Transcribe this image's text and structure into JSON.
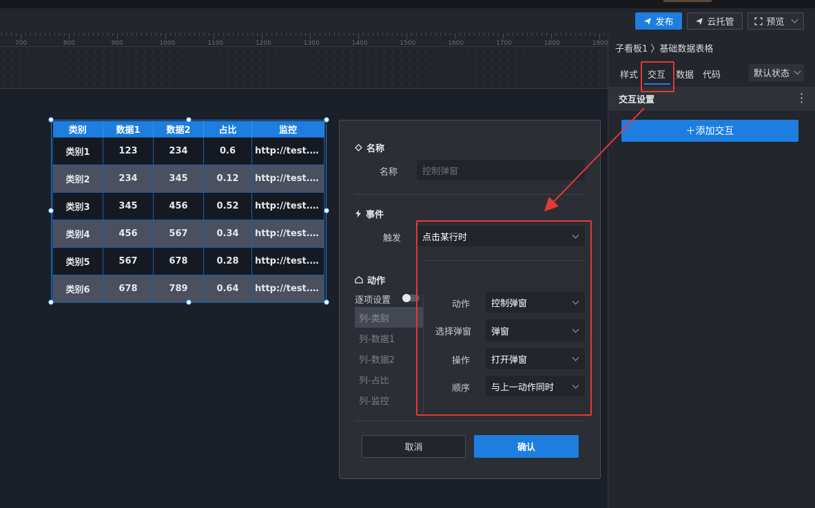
{
  "toolbar": {
    "publish_label": "发布",
    "cloud_label": "云托管",
    "preview_label": "预览"
  },
  "ruler": {
    "labels": [
      "700",
      "800",
      "900",
      "1000",
      "1100",
      "1200",
      "1300",
      "1400",
      "1500",
      "1600",
      "1700",
      "1800",
      "1900"
    ]
  },
  "table": {
    "headers": [
      "类别",
      "数据1",
      "数据2",
      "占比",
      "监控"
    ],
    "rows": [
      [
        "类别1",
        "123",
        "234",
        "0.6",
        "http://test.sha..."
      ],
      [
        "类别2",
        "234",
        "345",
        "0.12",
        "http://test.sha..."
      ],
      [
        "类别3",
        "345",
        "456",
        "0.52",
        "http://test.sha..."
      ],
      [
        "类别4",
        "456",
        "567",
        "0.34",
        "http://test.sha..."
      ],
      [
        "类别5",
        "567",
        "678",
        "0.28",
        "http://test.sha..."
      ],
      [
        "类别6",
        "678",
        "789",
        "0.64",
        "http://test.sha..."
      ]
    ]
  },
  "dialog": {
    "name_section": "名称",
    "name_label": "名称",
    "name_placeholder": "控制弹窗",
    "event_section": "事件",
    "trigger_label": "触发",
    "trigger_value": "点击某行时",
    "action_section": "动作",
    "per_item_label": "逐项设置",
    "columns": [
      "列-类别",
      "列-数据1",
      "列-数据2",
      "列-占比",
      "列-监控"
    ],
    "action_label": "动作",
    "action_value": "控制弹窗",
    "select_popup_label": "选择弹窗",
    "select_popup_value": "弹窗",
    "operation_label": "操作",
    "operation_value": "打开弹窗",
    "order_label": "顺序",
    "order_value": "与上一动作同时",
    "cancel_label": "取消",
    "confirm_label": "确认"
  },
  "right_panel": {
    "breadcrumb": "子看板1 〉基础数据表格",
    "tabs": [
      "样式",
      "交互",
      "数据",
      "代码"
    ],
    "active_tab": "交互",
    "state_select": "默认状态",
    "subheader_title": "交互设置",
    "add_button": "＋添加交互"
  },
  "colors": {
    "accent": "#1d7ee0",
    "annotation": "#e53935"
  }
}
